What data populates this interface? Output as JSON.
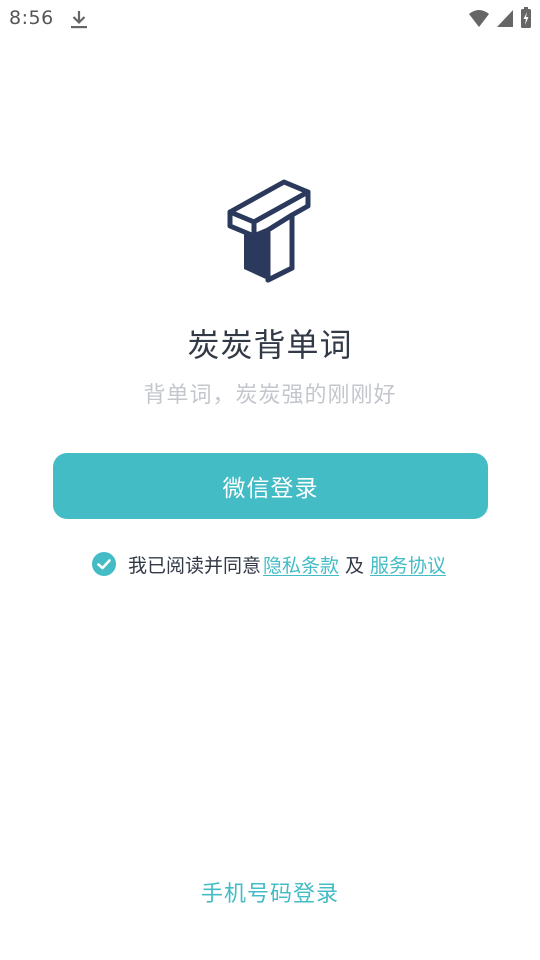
{
  "status_bar": {
    "time": "8:56",
    "icons": [
      "download-icon",
      "wifi-icon",
      "signal-icon",
      "battery-charging-icon"
    ]
  },
  "app": {
    "logo_icon": "tanta-logo-icon",
    "title": "炭炭背单词",
    "slogan": "背单词，炭炭强的刚刚好"
  },
  "login": {
    "wechat_label": "微信登录",
    "agreement_text": "我已阅读并同意",
    "privacy_link": "隐私条款",
    "and_text": "及",
    "service_link": "服务协议",
    "agreement_checked": true,
    "phone_login_label": "手机号码登录"
  },
  "colors": {
    "accent": "#44bcc6",
    "logo_dark": "#2b3a5c",
    "title_text": "#333a47",
    "slogan_text": "#c3c7cd"
  }
}
